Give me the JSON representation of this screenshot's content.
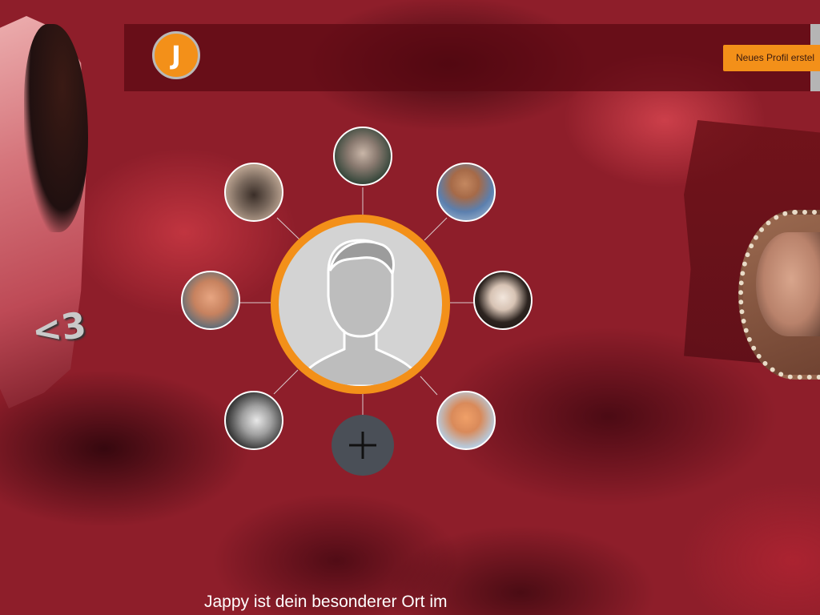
{
  "header": {
    "logo_letter": "J",
    "cta_label": "Neues Profil erstel"
  },
  "network": {
    "center_avatar": "placeholder-silhouette",
    "friends": [
      "friend-photo-top",
      "friend-photo-top-right",
      "friend-photo-right",
      "friend-photo-bottom-right",
      "friend-photo-bottom-left",
      "friend-photo-left",
      "friend-photo-top-left"
    ],
    "add_icon": "plus-icon"
  },
  "tagline": "Jappy ist dein besonderer Ort im",
  "colors": {
    "brand": "#f39019",
    "background": "#8e1e2a",
    "add_button": "#4a4f57"
  }
}
